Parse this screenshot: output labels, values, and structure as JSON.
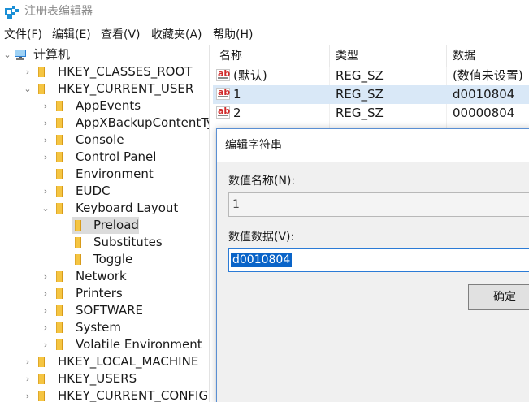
{
  "window": {
    "title": "注册表编辑器",
    "icon": "regedit-icon"
  },
  "menu": {
    "items": [
      "文件(F)",
      "编辑(E)",
      "查看(V)",
      "收藏夹(A)",
      "帮助(H)"
    ]
  },
  "tree": {
    "root_label": "计算机",
    "root_expander": "⌄",
    "rows": [
      {
        "label": "HKEY_CLASSES_ROOT",
        "expander": "›"
      },
      {
        "label": "HKEY_CURRENT_USER",
        "expander": "⌄"
      },
      {
        "label": "AppEvents",
        "expander": "›"
      },
      {
        "label": "AppXBackupContentTy",
        "expander": "›"
      },
      {
        "label": "Console",
        "expander": "›"
      },
      {
        "label": "Control Panel",
        "expander": "›"
      },
      {
        "label": "Environment",
        "expander": ""
      },
      {
        "label": "EUDC",
        "expander": "›"
      },
      {
        "label": "Keyboard Layout",
        "expander": "⌄"
      },
      {
        "label": "Preload",
        "expander": ""
      },
      {
        "label": "Substitutes",
        "expander": ""
      },
      {
        "label": "Toggle",
        "expander": ""
      },
      {
        "label": "Network",
        "expander": "›"
      },
      {
        "label": "Printers",
        "expander": "›"
      },
      {
        "label": "SOFTWARE",
        "expander": "›"
      },
      {
        "label": "System",
        "expander": "›"
      },
      {
        "label": "Volatile Environment",
        "expander": "›"
      },
      {
        "label": "HKEY_LOCAL_MACHINE",
        "expander": "›"
      },
      {
        "label": "HKEY_USERS",
        "expander": "›"
      },
      {
        "label": "HKEY_CURRENT_CONFIG",
        "expander": "›"
      }
    ]
  },
  "list": {
    "headers": {
      "name": "名称",
      "type": "类型",
      "data": "数据"
    },
    "rows": [
      {
        "icon_text": "ab",
        "name": "(默认)",
        "type": "REG_SZ",
        "data": "(数值未设置)"
      },
      {
        "icon_text": "ab",
        "name": "1",
        "type": "REG_SZ",
        "data": "d0010804"
      },
      {
        "icon_text": "ab",
        "name": "2",
        "type": "REG_SZ",
        "data": "00000804"
      }
    ]
  },
  "dialog": {
    "title": "编辑字符串",
    "name_label": "数值名称(N):",
    "name_value": "1",
    "data_label": "数值数据(V):",
    "data_value": "d0010804",
    "ok_label": "确定"
  },
  "colors": {
    "selection_blue": "#0a64c8",
    "folder_yellow": "#f5c542",
    "dialog_border": "#5a8fd3"
  }
}
